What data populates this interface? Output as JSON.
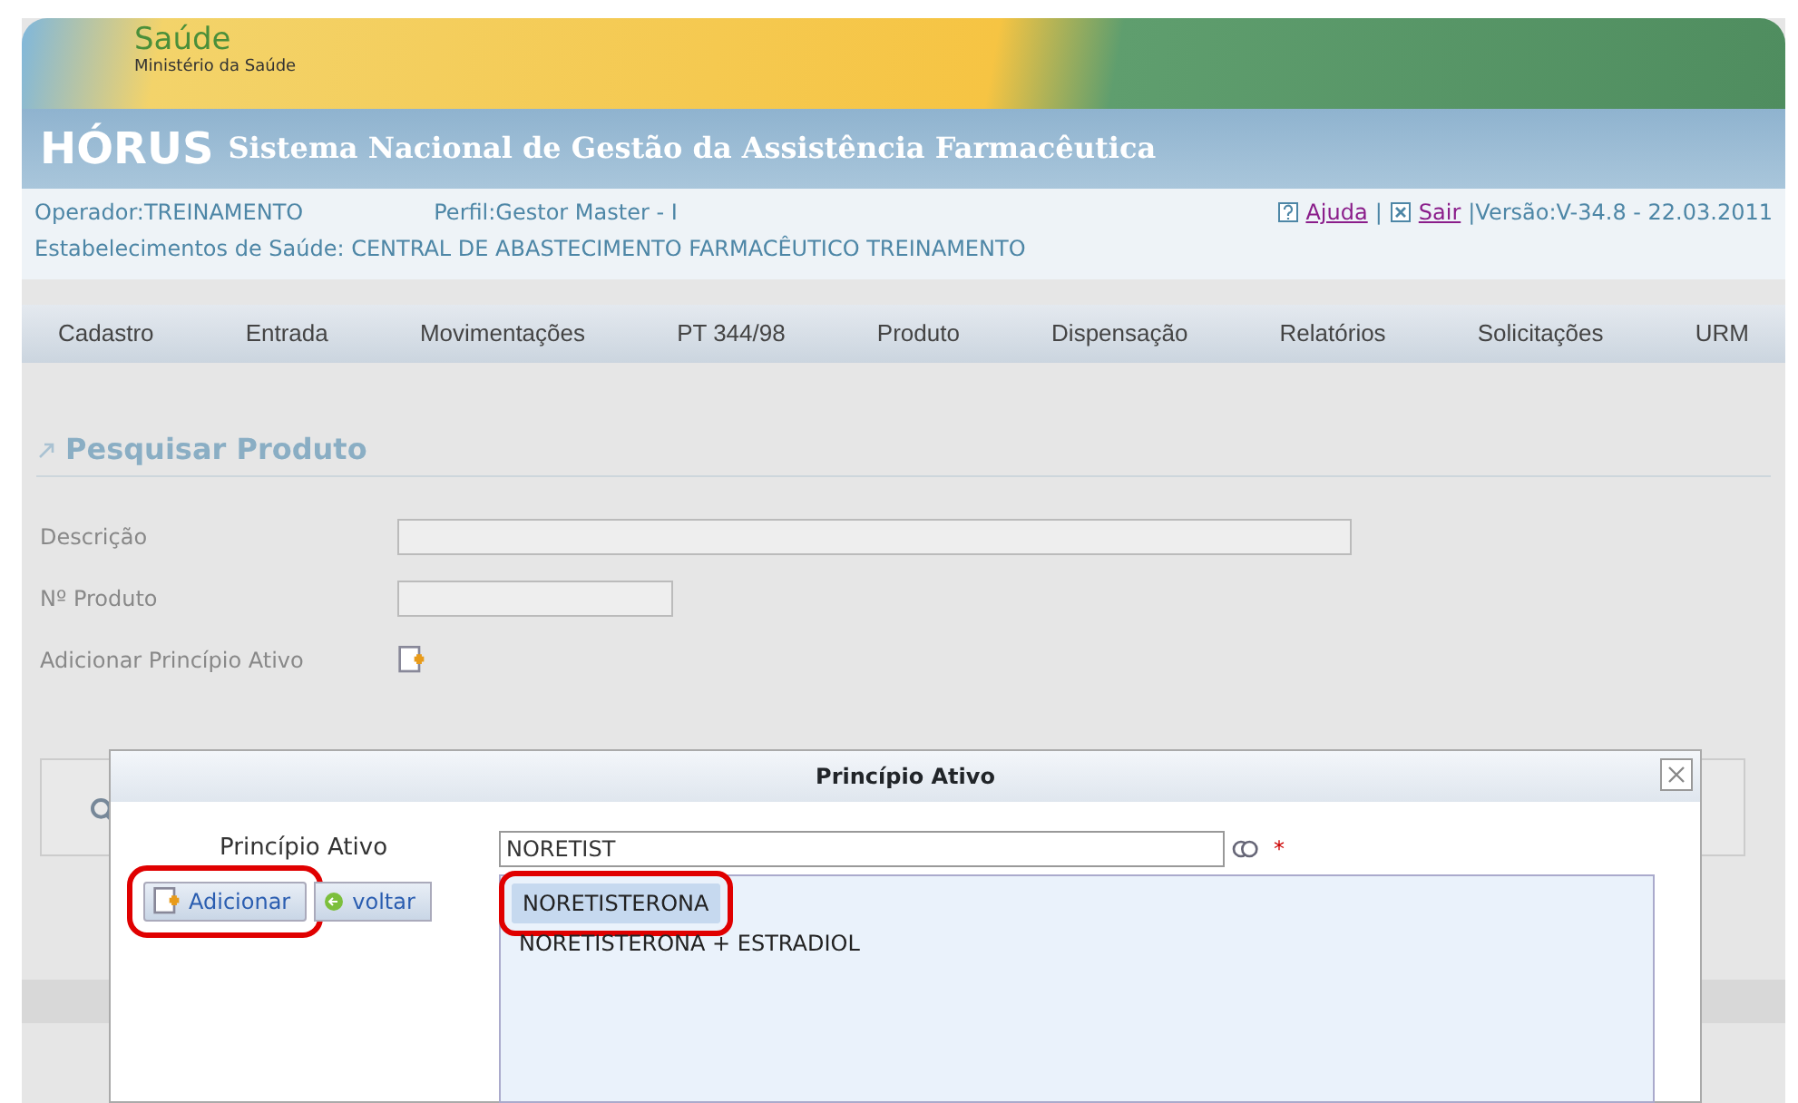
{
  "brand": {
    "title": "Saúde",
    "subtitle": "Ministério da Saúde"
  },
  "app": {
    "name": "HÓRUS",
    "title": "Sistema Nacional de Gestão da Assistência Farmacêutica"
  },
  "info": {
    "operator": "Operador:TREINAMENTO",
    "profile": "Perfil:Gestor Master - I",
    "help": "Ajuda",
    "separator": "|",
    "exit": "Sair",
    "version": "|Versão:V-34.8 - 22.03.2011",
    "establishment": "Estabelecimentos de Saúde: CENTRAL DE ABASTECIMENTO FARMACÊUTICO TREINAMENTO"
  },
  "menu": [
    {
      "label": "Cadastro"
    },
    {
      "label": "Entrada"
    },
    {
      "label": "Movimentações"
    },
    {
      "label": "PT 344/98"
    },
    {
      "label": "Produto"
    },
    {
      "label": "Dispensação"
    },
    {
      "label": "Relatórios"
    },
    {
      "label": "Solicitações"
    },
    {
      "label": "URM"
    }
  ],
  "page_title": "Pesquisar Produto",
  "fields": [
    {
      "label": "Descrição",
      "kind": "longtext"
    },
    {
      "label": "Nº Produto",
      "kind": "shorttext"
    },
    {
      "label": "Adicionar Princípio Ativo",
      "kind": "add"
    }
  ],
  "dialog": {
    "title": "Princípio Ativo",
    "field_label": "Princípio Ativo",
    "value": "NORETIST",
    "required_mark": "*",
    "buttons": [
      {
        "label": "Adicionar",
        "kind": "add",
        "highlighted": true
      },
      {
        "label": "voltar",
        "kind": "back",
        "highlighted": false
      }
    ],
    "suggestions": [
      {
        "label": "NORETISTERONA",
        "selected": true,
        "highlighted": true
      },
      {
        "label": "NORETISTERONA + ESTRADIOL",
        "selected": false,
        "highlighted": false
      }
    ]
  }
}
